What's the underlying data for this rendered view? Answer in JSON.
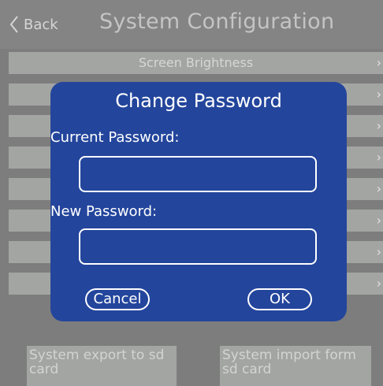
{
  "header": {
    "back_label": "Back",
    "title": "System Configuration"
  },
  "rows": [
    {
      "label": "Screen Brightness"
    },
    {
      "label": ""
    },
    {
      "label": ""
    },
    {
      "label": ""
    },
    {
      "label": ""
    },
    {
      "label": ""
    },
    {
      "label": ""
    },
    {
      "label": ""
    }
  ],
  "chevron": "›",
  "dialog": {
    "title": "Change Password",
    "current_label": "Current Password:",
    "current_value": "",
    "new_label": "New Password:",
    "new_value": "",
    "cancel_label": "Cancel",
    "ok_label": "OK"
  },
  "bottom": {
    "export_label": "System export to sd card",
    "import_label": "System import form sd card"
  },
  "colors": {
    "background": "#7d7d7d",
    "row": "#a3a5a3",
    "dialog": "#23459c"
  }
}
